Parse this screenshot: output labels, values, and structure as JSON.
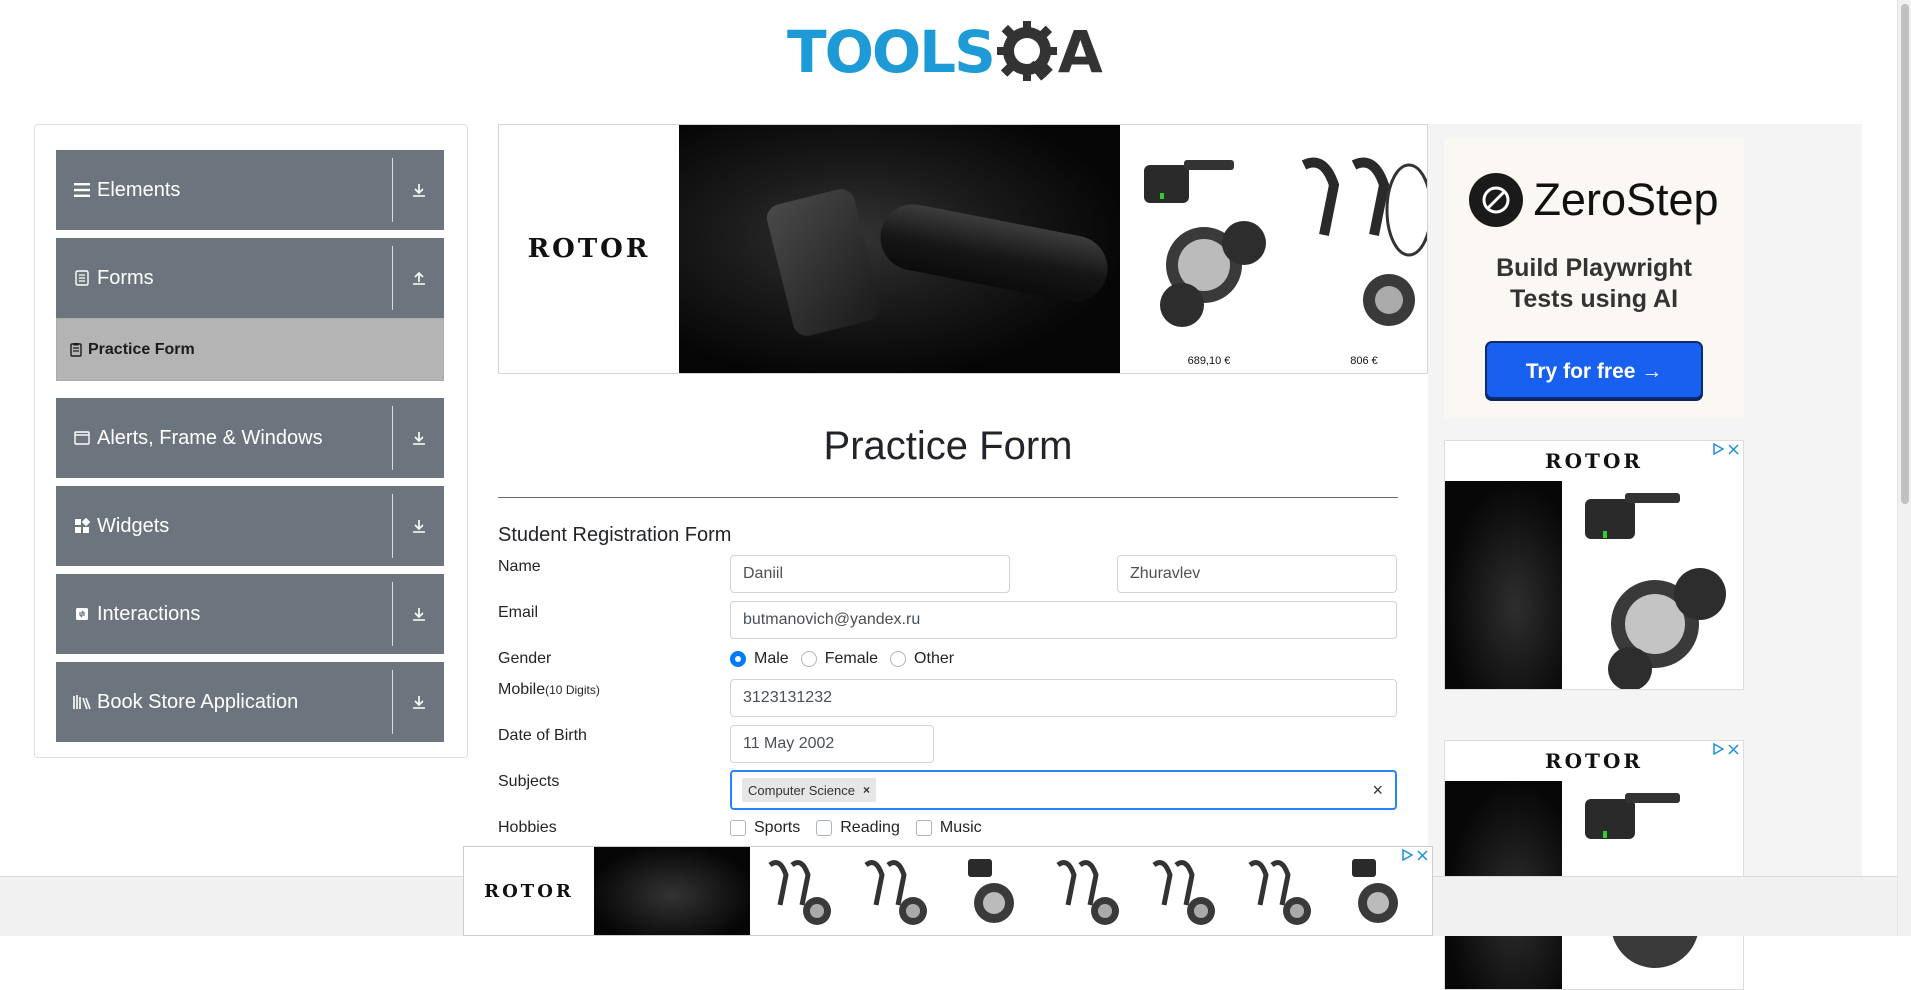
{
  "header": {
    "logo_main": "TOOLS",
    "logo_tail": "A",
    "logo_gear_letter": "Q"
  },
  "sidebar": {
    "groups": [
      {
        "label": "Elements",
        "icon": "hamburger-icon",
        "arrow": "download-arrow-icon"
      },
      {
        "label": "Forms",
        "icon": "document-icon",
        "arrow": "upload-arrow-icon"
      },
      {
        "label": "Alerts, Frame & Windows",
        "icon": "window-icon",
        "arrow": "download-arrow-icon"
      },
      {
        "label": "Widgets",
        "icon": "grid-icon",
        "arrow": "download-arrow-icon"
      },
      {
        "label": "Interactions",
        "icon": "interaction-icon",
        "arrow": "download-arrow-icon"
      },
      {
        "label": "Book Store Application",
        "icon": "books-icon",
        "arrow": "download-arrow-icon"
      }
    ],
    "active_item": {
      "label": "Practice Form",
      "icon": "form-icon"
    }
  },
  "top_ad": {
    "brand": "ROTOR",
    "prices": [
      "689,10 €",
      "806 €"
    ]
  },
  "right_ads": {
    "zerostep": {
      "name": "ZeroStep",
      "tagline_1": "Build Playwright",
      "tagline_2": "Tests using AI",
      "cta": "Try for free →"
    },
    "rotor_1": {
      "brand": "ROTOR"
    },
    "rotor_2": {
      "brand": "ROTOR"
    }
  },
  "main": {
    "title": "Practice Form",
    "form_title": "Student Registration Form",
    "labels": {
      "name": "Name",
      "email": "Email",
      "gender": "Gender",
      "mobile": "Mobile",
      "mobile_hint": "(10 Digits)",
      "dob": "Date of Birth",
      "subjects": "Subjects",
      "hobbies": "Hobbies"
    },
    "values": {
      "first_name": "Daniil",
      "last_name": "Zhuravlev",
      "email": "butmanovich@yandex.ru",
      "mobile": "3123131232",
      "dob": "11 May 2002"
    },
    "gender_options": [
      {
        "label": "Male",
        "selected": true
      },
      {
        "label": "Female",
        "selected": false
      },
      {
        "label": "Other",
        "selected": false
      }
    ],
    "subjects_selected": [
      "Computer Science"
    ],
    "subject_remove": "×",
    "subjects_clear": "×",
    "hobby_options": [
      {
        "label": "Sports",
        "checked": false
      },
      {
        "label": "Reading",
        "checked": false
      },
      {
        "label": "Music",
        "checked": false
      }
    ]
  },
  "bottom_ad": {
    "brand": "ROTOR"
  },
  "colors": {
    "brand_blue": "#1e9bd7",
    "sidebar_gray": "#6c757d",
    "active_item": "#b4b4b4",
    "accent": "#007bff",
    "cta_blue": "#1760f0"
  }
}
